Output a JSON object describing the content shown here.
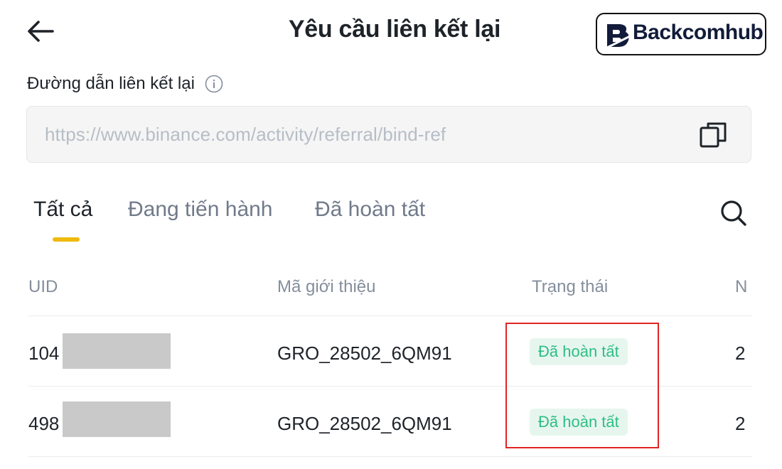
{
  "header": {
    "title": "Yêu cầu liên kết lại",
    "back_icon": "arrow-left-icon",
    "brand": "Backcomhub"
  },
  "link": {
    "label": "Đường dẫn liên kết lại",
    "info_icon": "info-icon",
    "value": "https://www.binance.com/activity/referral/bind-ref",
    "copy_icon": "copy-icon"
  },
  "tabs": [
    {
      "label": "Tất cả",
      "active": true
    },
    {
      "label": "Đang tiến hành",
      "active": false
    },
    {
      "label": "Đã hoàn tất",
      "active": false
    }
  ],
  "search_icon": "search-icon",
  "table": {
    "headers": [
      "UID",
      "Mã giới thiệu",
      "Trạng thái",
      "N"
    ],
    "rows": [
      {
        "uid": "104",
        "code": "GRO_28502_6QM91",
        "status": "Đã hoàn tất",
        "n": "2"
      },
      {
        "uid": "498",
        "code": "GRO_28502_6QM91",
        "status": "Đã hoàn tất",
        "n": "2"
      }
    ]
  },
  "colors": {
    "accent": "#f0b90b",
    "status_green": "#2ebd85",
    "status_bg": "#e6f6ee",
    "highlight": "#e02424"
  }
}
